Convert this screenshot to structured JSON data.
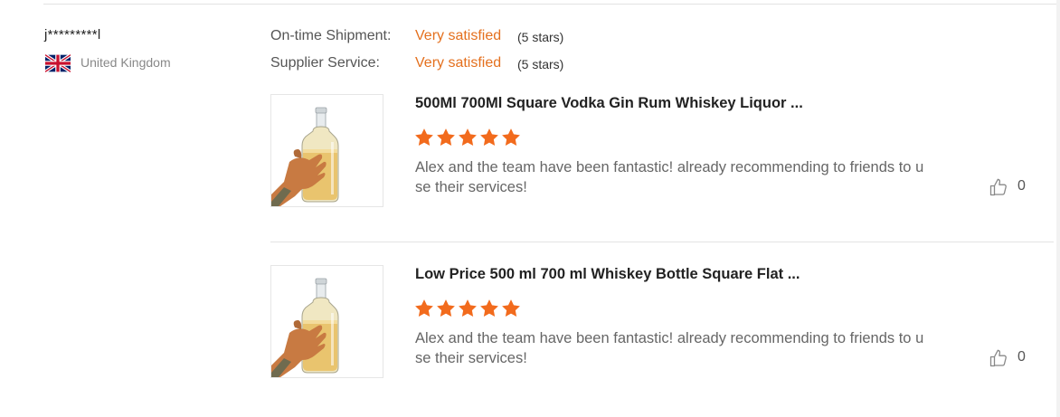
{
  "reviewer": {
    "name": "j*********l",
    "country": "United Kingdom",
    "flag_icon": "uk-flag-icon"
  },
  "ratings": [
    {
      "label": "On-time Shipment:",
      "value": "Very satisfied",
      "stars": "(5 stars)"
    },
    {
      "label": "Supplier Service:",
      "value": "Very satisfied",
      "stars": "(5 stars)"
    }
  ],
  "reviews": [
    {
      "product_title": "500Ml 700Ml Square Vodka Gin Rum Whiskey Liquor ...",
      "rating": 5,
      "text": "Alex and the team have been fantastic! already recommending to friends to use their services!",
      "likes": "0",
      "thumbnail_icon": "bottle-thumbnail"
    },
    {
      "product_title": "Low Price 500 ml 700 ml Whiskey Bottle Square Flat ...",
      "rating": 5,
      "text": "Alex and the team have been fantastic! already recommending to friends to use their services!",
      "likes": "0",
      "thumbnail_icon": "bottle-thumbnail"
    }
  ],
  "colors": {
    "accent": "#e4701e",
    "star": "#f26b1d"
  }
}
